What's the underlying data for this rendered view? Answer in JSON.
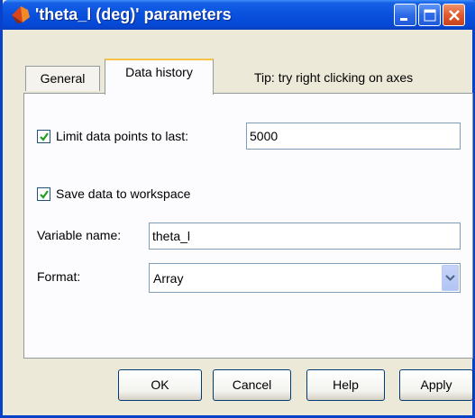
{
  "window": {
    "title": "'theta_l (deg)' parameters",
    "icon": "simulink-icon"
  },
  "titlebar_buttons": {
    "minimize": "minimize-icon",
    "maximize": "maximize-icon",
    "close": "close-icon"
  },
  "tabs": [
    {
      "label": "General",
      "selected": false
    },
    {
      "label": "Data history",
      "selected": true
    }
  ],
  "tip": "Tip: try right clicking on axes",
  "limit_points": {
    "label": "Limit data points to last:",
    "checked": true,
    "value": "5000"
  },
  "save_workspace": {
    "label": "Save data to workspace",
    "checked": true
  },
  "variable_name": {
    "label": "Variable name:",
    "value": "theta_l"
  },
  "format": {
    "label": "Format:",
    "value": "Array"
  },
  "buttons": {
    "ok": "OK",
    "cancel": "Cancel",
    "help": "Help",
    "apply": "Apply"
  },
  "colors": {
    "titlebar": "#0a52de",
    "check": "#21a121",
    "tab_highlight": "#f5c247"
  }
}
